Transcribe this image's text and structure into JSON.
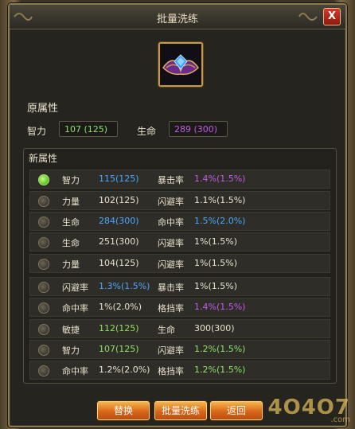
{
  "window": {
    "title": "批量洗练",
    "close": "X"
  },
  "original": {
    "heading": "原属性",
    "stats": [
      {
        "label": "智力",
        "value": "107 (125)",
        "color": "#8ee06a"
      },
      {
        "label": "生命",
        "value": "289 (300)",
        "color": "#c05ce8"
      }
    ]
  },
  "new_attrs": {
    "heading": "新属性",
    "rows": [
      {
        "selected": true,
        "a_label": "智力",
        "a_value": "115(125)",
        "a_color": "#4aa6ff",
        "b_label": "暴击率",
        "b_value": "1.4%(1.5%)",
        "b_color": "#c05ce8"
      },
      {
        "selected": false,
        "a_label": "力量",
        "a_value": "102(125)",
        "a_color": "#e8e2d0",
        "b_label": "闪避率",
        "b_value": "1.1%(1.5%)",
        "b_color": "#e8e2d0"
      },
      {
        "selected": false,
        "a_label": "生命",
        "a_value": "284(300)",
        "a_color": "#4aa6ff",
        "b_label": "命中率",
        "b_value": "1.5%(2.0%)",
        "b_color": "#4aa6ff"
      },
      {
        "selected": false,
        "a_label": "生命",
        "a_value": "251(300)",
        "a_color": "#e8e2d0",
        "b_label": "闪避率",
        "b_value": "1%(1.5%)",
        "b_color": "#e8e2d0"
      },
      {
        "selected": false,
        "a_label": "力量",
        "a_value": "104(125)",
        "a_color": "#e8e2d0",
        "b_label": "闪避率",
        "b_value": "1%(1.5%)",
        "b_color": "#e8e2d0"
      },
      {
        "selected": false,
        "a_label": "闪避率",
        "a_value": "1.3%(1.5%)",
        "a_color": "#4aa6ff",
        "b_label": "暴击率",
        "b_value": "1%(1.5%)",
        "b_color": "#e8e2d0"
      },
      {
        "selected": false,
        "a_label": "命中率",
        "a_value": "1%(2.0%)",
        "a_color": "#e8e2d0",
        "b_label": "格挡率",
        "b_value": "1.4%(1.5%)",
        "b_color": "#c05ce8"
      },
      {
        "selected": false,
        "a_label": "敏捷",
        "a_value": "112(125)",
        "a_color": "#8ee06a",
        "b_label": "生命",
        "b_value": "300(300)",
        "b_color": "#e8e2d0"
      },
      {
        "selected": false,
        "a_label": "智力",
        "a_value": "107(125)",
        "a_color": "#8ee06a",
        "b_label": "闪避率",
        "b_value": "1.2%(1.5%)",
        "b_color": "#8ee06a"
      },
      {
        "selected": false,
        "a_label": "命中率",
        "a_value": "1.2%(2.0%)",
        "a_color": "#e8e2d0",
        "b_label": "格挡率",
        "b_value": "1.2%(1.5%)",
        "b_color": "#8ee06a"
      }
    ]
  },
  "buttons": {
    "replace": "替换",
    "batch_refine": "批量洗练",
    "back": "返回"
  },
  "item_icon": "winged-gem-icon",
  "watermark": {
    "main": "4O4O7",
    "sub": ".com"
  }
}
